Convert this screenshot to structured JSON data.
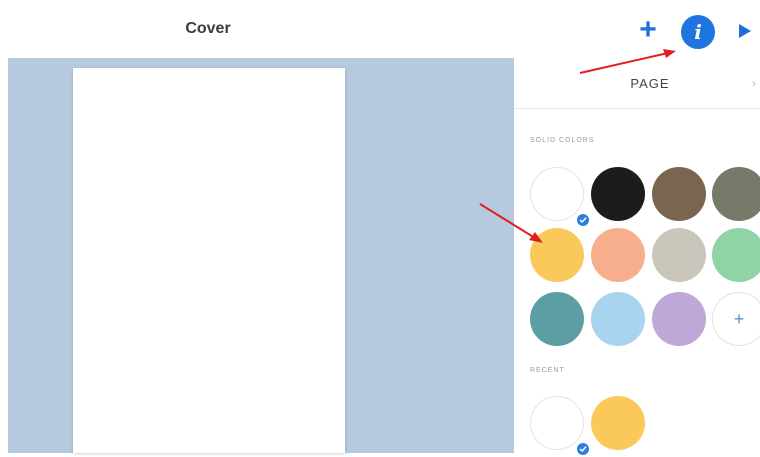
{
  "header": {
    "title": "Cover",
    "add_icon": "plus-icon",
    "add_glyph": "+",
    "info_icon": "info-icon",
    "info_glyph": "i",
    "play_icon": "play-icon"
  },
  "panel": {
    "tab_label": "PAGE",
    "solid_label": "SOLID COLORS",
    "recent_label": "RECENT",
    "add_glyph": "+",
    "solid_colors": [
      {
        "name": "white",
        "hex": "#ffffff",
        "selected": true
      },
      {
        "name": "black",
        "hex": "#1c1c1c"
      },
      {
        "name": "brown",
        "hex": "#7a6650"
      },
      {
        "name": "olive-gray",
        "hex": "#767a69"
      },
      {
        "name": "yellow",
        "hex": "#fac95a"
      },
      {
        "name": "peach",
        "hex": "#f7ae8d"
      },
      {
        "name": "light-gray",
        "hex": "#cbc6bb"
      },
      {
        "name": "mint",
        "hex": "#8fd3a6"
      },
      {
        "name": "teal",
        "hex": "#5b9ea3"
      },
      {
        "name": "sky-blue",
        "hex": "#a9d4ef"
      },
      {
        "name": "lavender",
        "hex": "#bfa8d8"
      }
    ],
    "recent_colors": [
      {
        "name": "white",
        "hex": "#ffffff",
        "selected": true
      },
      {
        "name": "yellow",
        "hex": "#fac95a"
      }
    ]
  },
  "colors": {
    "canvas_background": "#b7c9de",
    "accent": "#1f74e0",
    "annotation_arrow": "#e02020"
  }
}
